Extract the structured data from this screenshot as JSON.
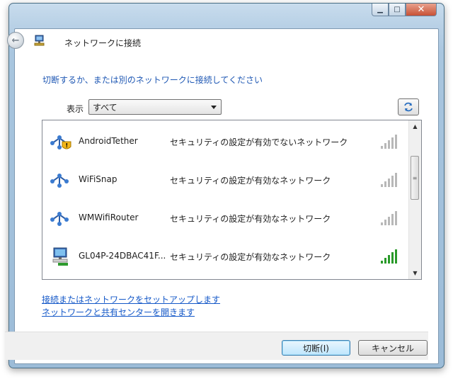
{
  "header": {
    "title": "ネットワークに接続"
  },
  "instruction": "切断するか、または別のネットワークに接続してください",
  "filter": {
    "label": "表示",
    "selected": "すべて"
  },
  "networks": [
    {
      "name": "AndroidTether",
      "status": "セキュリティの設定が有効でないネットワーク",
      "icon": "unsecured-wireless-icon",
      "signal_bars_lit": 0
    },
    {
      "name": "WiFiSnap",
      "status": "セキュリティの設定が有効なネットワーク",
      "icon": "wireless-network-icon",
      "signal_bars_lit": 0
    },
    {
      "name": "WMWifiRouter",
      "status": "セキュリティの設定が有効なネットワーク",
      "icon": "wireless-network-icon",
      "signal_bars_lit": 0
    },
    {
      "name": "GL04P-24DBAC41F...",
      "status": "セキュリティの設定が有効なネットワーク",
      "icon": "connected-network-icon",
      "signal_bars_lit": 5
    }
  ],
  "links": [
    "接続またはネットワークをセットアップします",
    "ネットワークと共有センターを開きます"
  ],
  "buttons": {
    "disconnect": "切断(I)",
    "cancel": "キャンセル"
  },
  "colors": {
    "link": "#1458c8",
    "instruction": "#1f58b4",
    "signal_on": "#2a9a2a",
    "signal_off": "#b8b8b8"
  }
}
